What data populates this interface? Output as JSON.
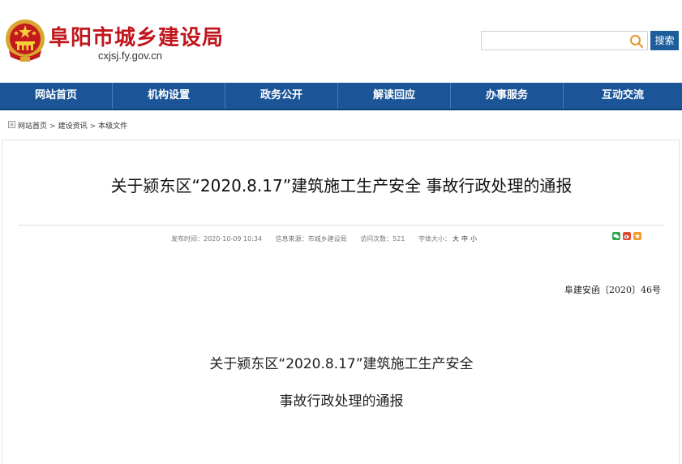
{
  "header": {
    "site_title": "阜阳市城乡建设局",
    "site_domain": "cxjsj.fy.gov.cn",
    "search_placeholder": "",
    "search_button": "搜索"
  },
  "nav": {
    "items": [
      {
        "label": "网站首页"
      },
      {
        "label": "机构设置"
      },
      {
        "label": "政务公开"
      },
      {
        "label": "解读回应"
      },
      {
        "label": "办事服务"
      },
      {
        "label": "互动交流"
      }
    ]
  },
  "breadcrumb": {
    "items": [
      "网站首页",
      "建设资讯",
      "本级文件"
    ],
    "separator": ">"
  },
  "article": {
    "title": "关于颍东区“2020.8.17”建筑施工生产安全 事故行政处理的通报",
    "meta": {
      "publish_time": "发布时间：2020-10-09 10:34",
      "source": "信息来源：市城乡建设局",
      "views": "访问次数：521",
      "font_size_label": "字体大小：",
      "font_large": "大",
      "font_medium": "中",
      "font_small": "小"
    },
    "share_icons": [
      "wechat-icon",
      "weibo-icon",
      "favorite-icon"
    ],
    "doc_number": "阜建安函〔2020〕46号",
    "body_line1": "关于颍东区“2020.8.17”建筑施工生产安全",
    "body_line2": "事故行政处理的通报"
  },
  "colors": {
    "brand_red": "#c0161c",
    "nav_blue": "#1b5598",
    "search_blue": "#1d5d9b"
  }
}
